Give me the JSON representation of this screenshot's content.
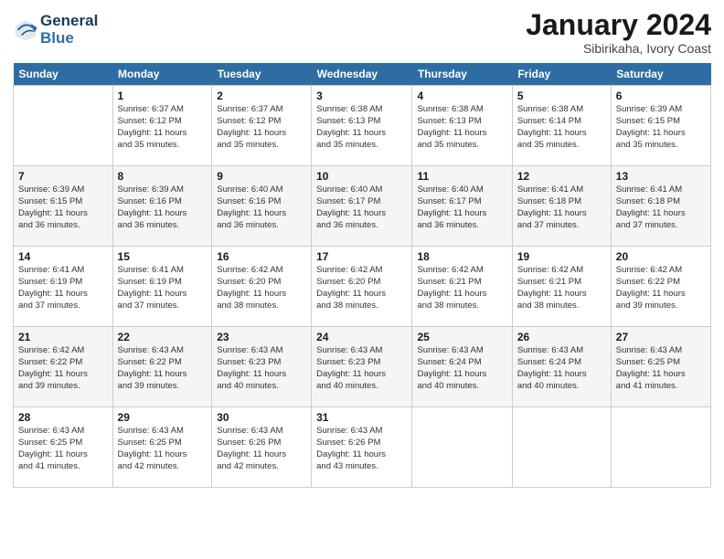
{
  "logo": {
    "line1": "General",
    "line2": "Blue"
  },
  "title": "January 2024",
  "subtitle": "Sibirikaha, Ivory Coast",
  "days_header": [
    "Sunday",
    "Monday",
    "Tuesday",
    "Wednesday",
    "Thursday",
    "Friday",
    "Saturday"
  ],
  "weeks": [
    [
      {
        "day": "",
        "info": ""
      },
      {
        "day": "1",
        "info": "Sunrise: 6:37 AM\nSunset: 6:12 PM\nDaylight: 11 hours\nand 35 minutes."
      },
      {
        "day": "2",
        "info": "Sunrise: 6:37 AM\nSunset: 6:12 PM\nDaylight: 11 hours\nand 35 minutes."
      },
      {
        "day": "3",
        "info": "Sunrise: 6:38 AM\nSunset: 6:13 PM\nDaylight: 11 hours\nand 35 minutes."
      },
      {
        "day": "4",
        "info": "Sunrise: 6:38 AM\nSunset: 6:13 PM\nDaylight: 11 hours\nand 35 minutes."
      },
      {
        "day": "5",
        "info": "Sunrise: 6:38 AM\nSunset: 6:14 PM\nDaylight: 11 hours\nand 35 minutes."
      },
      {
        "day": "6",
        "info": "Sunrise: 6:39 AM\nSunset: 6:15 PM\nDaylight: 11 hours\nand 35 minutes."
      }
    ],
    [
      {
        "day": "7",
        "info": "Sunrise: 6:39 AM\nSunset: 6:15 PM\nDaylight: 11 hours\nand 36 minutes."
      },
      {
        "day": "8",
        "info": "Sunrise: 6:39 AM\nSunset: 6:16 PM\nDaylight: 11 hours\nand 36 minutes."
      },
      {
        "day": "9",
        "info": "Sunrise: 6:40 AM\nSunset: 6:16 PM\nDaylight: 11 hours\nand 36 minutes."
      },
      {
        "day": "10",
        "info": "Sunrise: 6:40 AM\nSunset: 6:17 PM\nDaylight: 11 hours\nand 36 minutes."
      },
      {
        "day": "11",
        "info": "Sunrise: 6:40 AM\nSunset: 6:17 PM\nDaylight: 11 hours\nand 36 minutes."
      },
      {
        "day": "12",
        "info": "Sunrise: 6:41 AM\nSunset: 6:18 PM\nDaylight: 11 hours\nand 37 minutes."
      },
      {
        "day": "13",
        "info": "Sunrise: 6:41 AM\nSunset: 6:18 PM\nDaylight: 11 hours\nand 37 minutes."
      }
    ],
    [
      {
        "day": "14",
        "info": "Sunrise: 6:41 AM\nSunset: 6:19 PM\nDaylight: 11 hours\nand 37 minutes."
      },
      {
        "day": "15",
        "info": "Sunrise: 6:41 AM\nSunset: 6:19 PM\nDaylight: 11 hours\nand 37 minutes."
      },
      {
        "day": "16",
        "info": "Sunrise: 6:42 AM\nSunset: 6:20 PM\nDaylight: 11 hours\nand 38 minutes."
      },
      {
        "day": "17",
        "info": "Sunrise: 6:42 AM\nSunset: 6:20 PM\nDaylight: 11 hours\nand 38 minutes."
      },
      {
        "day": "18",
        "info": "Sunrise: 6:42 AM\nSunset: 6:21 PM\nDaylight: 11 hours\nand 38 minutes."
      },
      {
        "day": "19",
        "info": "Sunrise: 6:42 AM\nSunset: 6:21 PM\nDaylight: 11 hours\nand 38 minutes."
      },
      {
        "day": "20",
        "info": "Sunrise: 6:42 AM\nSunset: 6:22 PM\nDaylight: 11 hours\nand 39 minutes."
      }
    ],
    [
      {
        "day": "21",
        "info": "Sunrise: 6:42 AM\nSunset: 6:22 PM\nDaylight: 11 hours\nand 39 minutes."
      },
      {
        "day": "22",
        "info": "Sunrise: 6:43 AM\nSunset: 6:22 PM\nDaylight: 11 hours\nand 39 minutes."
      },
      {
        "day": "23",
        "info": "Sunrise: 6:43 AM\nSunset: 6:23 PM\nDaylight: 11 hours\nand 40 minutes."
      },
      {
        "day": "24",
        "info": "Sunrise: 6:43 AM\nSunset: 6:23 PM\nDaylight: 11 hours\nand 40 minutes."
      },
      {
        "day": "25",
        "info": "Sunrise: 6:43 AM\nSunset: 6:24 PM\nDaylight: 11 hours\nand 40 minutes."
      },
      {
        "day": "26",
        "info": "Sunrise: 6:43 AM\nSunset: 6:24 PM\nDaylight: 11 hours\nand 40 minutes."
      },
      {
        "day": "27",
        "info": "Sunrise: 6:43 AM\nSunset: 6:25 PM\nDaylight: 11 hours\nand 41 minutes."
      }
    ],
    [
      {
        "day": "28",
        "info": "Sunrise: 6:43 AM\nSunset: 6:25 PM\nDaylight: 11 hours\nand 41 minutes."
      },
      {
        "day": "29",
        "info": "Sunrise: 6:43 AM\nSunset: 6:25 PM\nDaylight: 11 hours\nand 42 minutes."
      },
      {
        "day": "30",
        "info": "Sunrise: 6:43 AM\nSunset: 6:26 PM\nDaylight: 11 hours\nand 42 minutes."
      },
      {
        "day": "31",
        "info": "Sunrise: 6:43 AM\nSunset: 6:26 PM\nDaylight: 11 hours\nand 43 minutes."
      },
      {
        "day": "",
        "info": ""
      },
      {
        "day": "",
        "info": ""
      },
      {
        "day": "",
        "info": ""
      }
    ]
  ]
}
